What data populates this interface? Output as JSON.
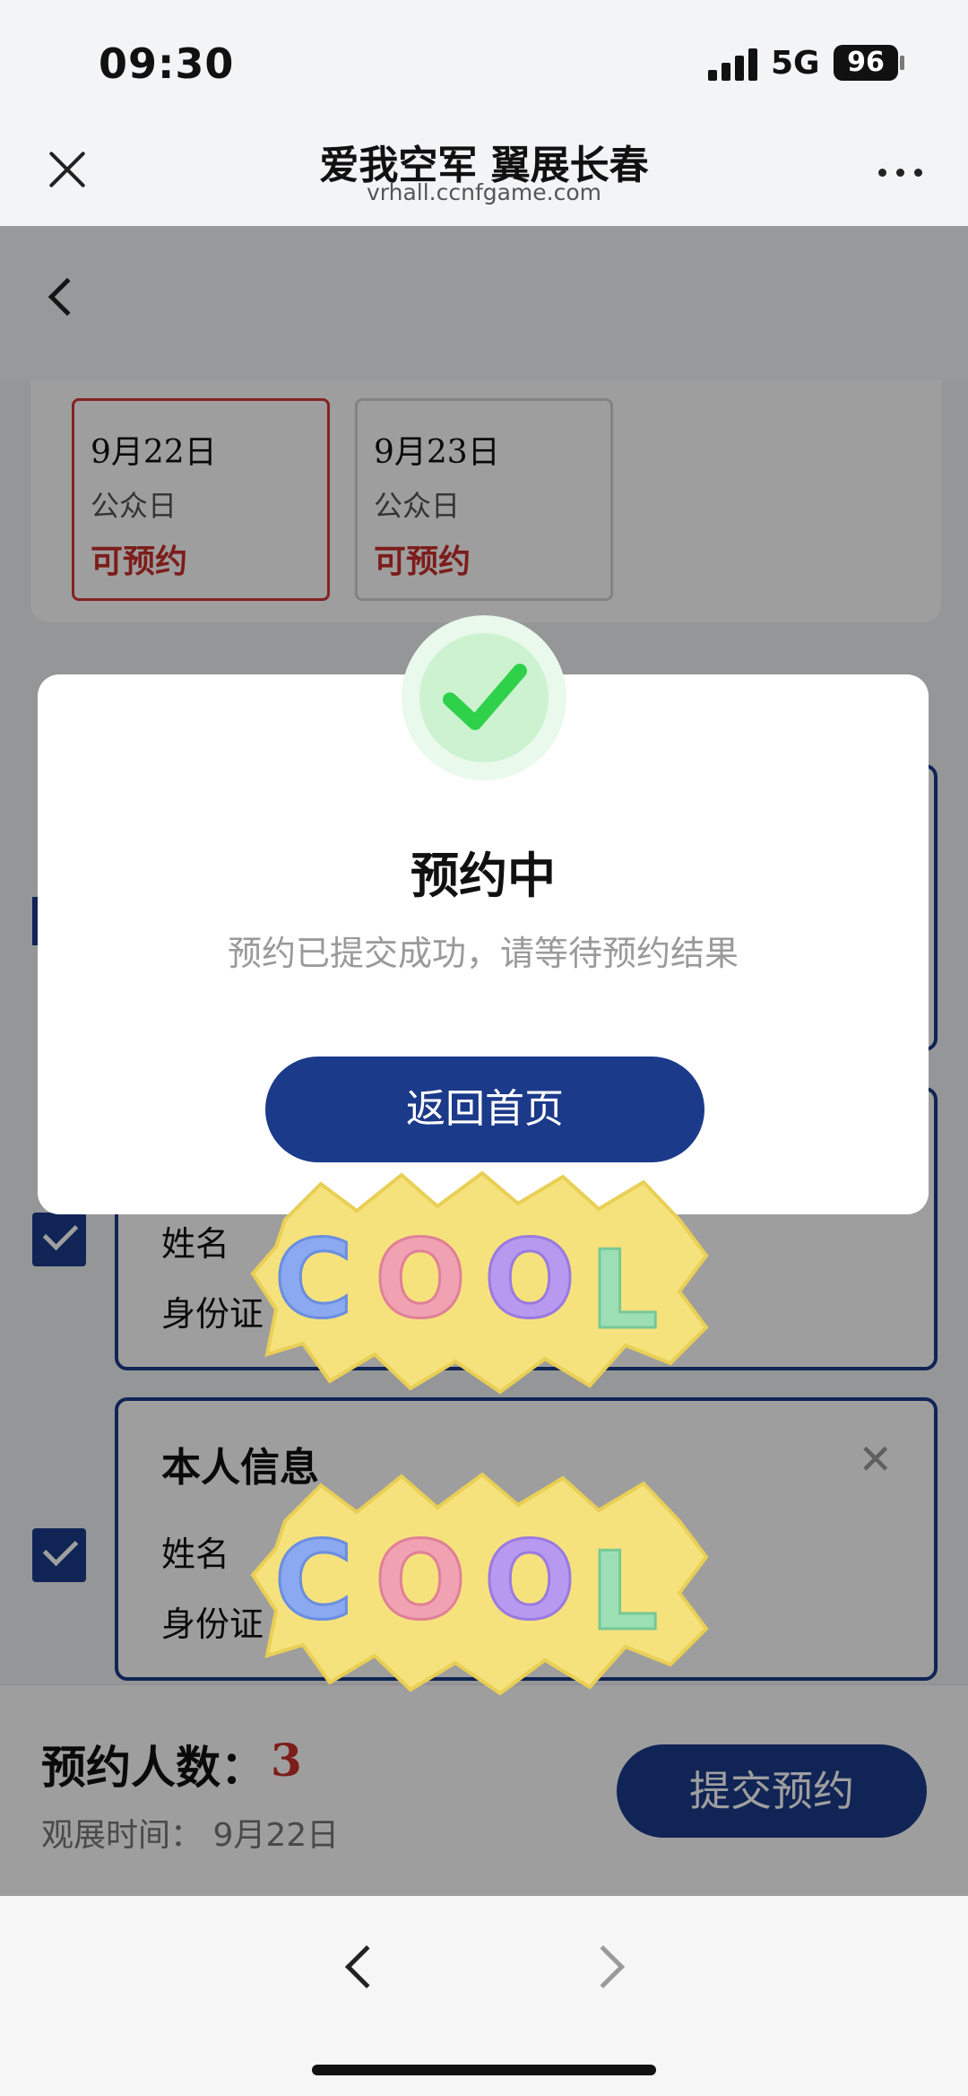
{
  "status_bar": {
    "time": "09:30",
    "network": "5G",
    "battery": "96"
  },
  "browser": {
    "title": "爱我空军 翼展长春",
    "url": "vrhall.ccnfgame.com"
  },
  "dates": [
    {
      "date": "9月22日",
      "type": "公众日",
      "status": "可预约",
      "selected": true
    },
    {
      "date": "9月23日",
      "type": "公众日",
      "status": "可预约",
      "selected": false
    }
  ],
  "persons": [
    {
      "title": "",
      "name_label": "姓名",
      "id_label": "身份证"
    },
    {
      "title": "本人信息",
      "name_label": "姓名",
      "id_label": "身份证"
    }
  ],
  "footer": {
    "count_label": "预约人数：",
    "count": "3",
    "visit_time": "观展时间：  9月22日",
    "submit": "提交预约"
  },
  "modal": {
    "title": "预约中",
    "subtitle": "预约已提交成功，请等待预约结果",
    "button": "返回首页"
  },
  "sticker": {
    "text": "COOL"
  },
  "colors": {
    "primary": "#1b3a8a",
    "accent_red": "#c9302c",
    "success": "#2fd14a"
  }
}
